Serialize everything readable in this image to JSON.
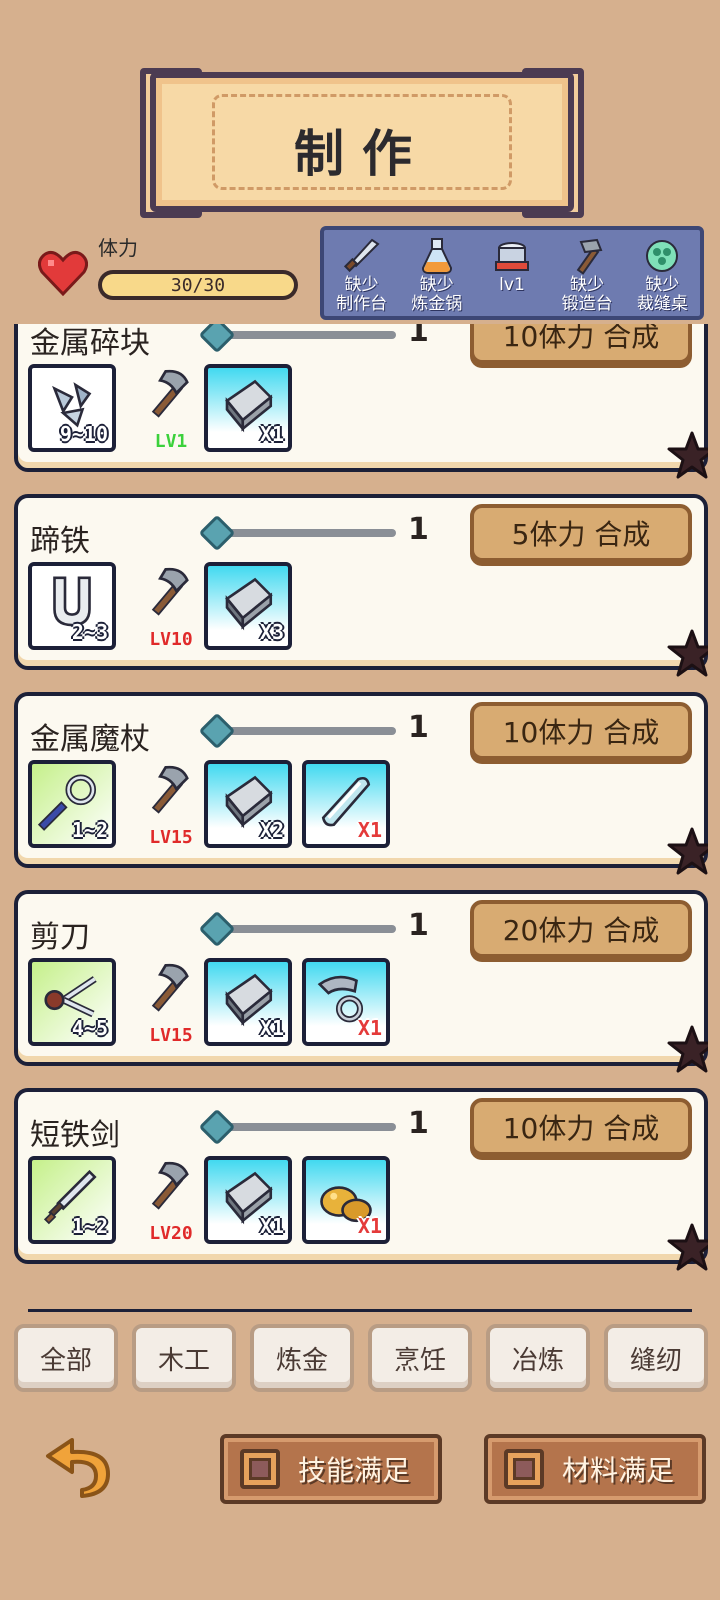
{
  "header": {
    "title": "制作"
  },
  "stamina": {
    "label": "体力",
    "value": "30/30",
    "fill": 1.0
  },
  "stations": [
    {
      "icon": "knife-icon",
      "line1": "缺少",
      "line2": "制作台"
    },
    {
      "icon": "potion-flask-icon",
      "line1": "缺少",
      "line2": "炼金锅"
    },
    {
      "icon": "cooking-pot-icon",
      "line1": "",
      "line2": "lv1"
    },
    {
      "icon": "hammer-icon",
      "line1": "缺少",
      "line2": "锻造台"
    },
    {
      "icon": "yarn-ball-icon",
      "line1": "缺少",
      "line2": "裁缝桌"
    }
  ],
  "recipes": [
    {
      "name": "金属碎块",
      "qty": "1",
      "button": "10体力 合成",
      "result_count": "9~10",
      "result_bg": "white",
      "result_icon": "metal-shards-icon",
      "tool_icon": "axe-icon",
      "tool_level": "LV1",
      "tool_ok": true,
      "materials": [
        {
          "icon": "iron-ingot-icon",
          "count": "X1",
          "enough": true
        }
      ]
    },
    {
      "name": "蹄铁",
      "qty": "1",
      "button": "5体力 合成",
      "result_count": "2~3",
      "result_bg": "white",
      "result_icon": "horseshoe-icon",
      "tool_icon": "axe-icon",
      "tool_level": "LV10",
      "tool_ok": false,
      "materials": [
        {
          "icon": "iron-ingot-icon",
          "count": "X3",
          "enough": true
        }
      ]
    },
    {
      "name": "金属魔杖",
      "qty": "1",
      "button": "10体力 合成",
      "result_count": "1~2",
      "result_bg": "green",
      "result_icon": "magic-wand-icon",
      "tool_icon": "axe-icon",
      "tool_level": "LV15",
      "tool_ok": false,
      "materials": [
        {
          "icon": "iron-ingot-icon",
          "count": "X2",
          "enough": true
        },
        {
          "icon": "crystal-bar-icon",
          "count": "X1",
          "enough": false
        }
      ]
    },
    {
      "name": "剪刀",
      "qty": "1",
      "button": "20体力 合成",
      "result_count": "4~5",
      "result_bg": "green",
      "result_icon": "scissors-icon",
      "tool_icon": "axe-icon",
      "tool_level": "LV15",
      "tool_ok": false,
      "materials": [
        {
          "icon": "iron-ingot-icon",
          "count": "X1",
          "enough": true
        },
        {
          "icon": "metal-hook-icon",
          "count": "X1",
          "enough": false
        }
      ]
    },
    {
      "name": "短铁剑",
      "qty": "1",
      "button": "10体力 合成",
      "result_count": "1~2",
      "result_bg": "green",
      "result_icon": "short-sword-icon",
      "tool_icon": "axe-icon",
      "tool_level": "LV20",
      "tool_ok": false,
      "materials": [
        {
          "icon": "iron-ingot-icon",
          "count": "X1",
          "enough": true
        },
        {
          "icon": "gold-nugget-icon",
          "count": "X1",
          "enough": false
        }
      ]
    }
  ],
  "tabs": [
    "全部",
    "木工",
    "炼金",
    "烹饪",
    "冶炼",
    "缝纫"
  ],
  "filters": {
    "skill_label": "技能满足",
    "material_label": "材料满足"
  },
  "colors": {
    "background": "#d6b08e",
    "card": "#fcf9f0",
    "button": "#d8ab72",
    "station_panel": "#6e7bb0"
  }
}
